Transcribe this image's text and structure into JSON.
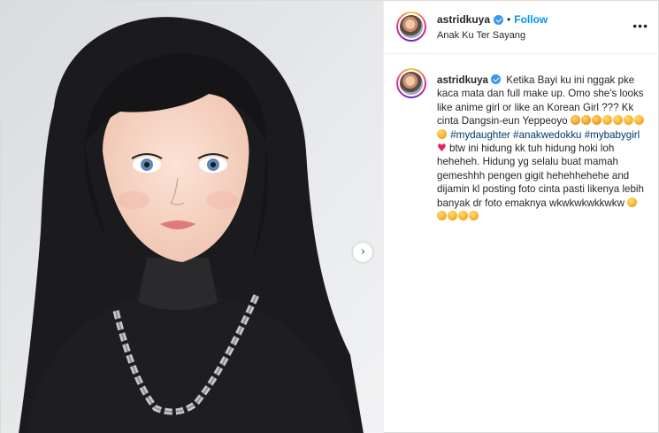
{
  "post": {
    "username": "astridkuya",
    "follow_label": "Follow",
    "separator": "•",
    "location": "Anak Ku Ter Sayang",
    "more_icon": "•••",
    "next_icon": "›"
  },
  "caption": {
    "username": "astridkuya",
    "text1": "Ketika Bayi ku ini nggak pke kaca mata dan full make up. Omo she's looks like anime girl or like an Korean Girl ??? Kk cinta Dangsin-eun Yeppeoyo",
    "tag1": "#mydaughter",
    "tag2": "#anakwedokku",
    "tag3": "#mybabygirl",
    "text2": "btw ini hidung kk tuh hidung hoki loh heheheh. Hidung yg selalu buat mamah gemeshhh pengen gigit hehehhehehe and dijamin kl posting foto cinta pasti likenya lebih banyak dr foto emaknya wkwkwkwkkwkw"
  },
  "colors": {
    "link": "#0095f6",
    "hashtag": "#00376b",
    "verified": "#3897f0",
    "heart": "#e0245e"
  },
  "icons": [
    "verified-badge-icon",
    "more-options-icon",
    "next-arrow-icon",
    "emoji-icon",
    "heart-icon"
  ]
}
